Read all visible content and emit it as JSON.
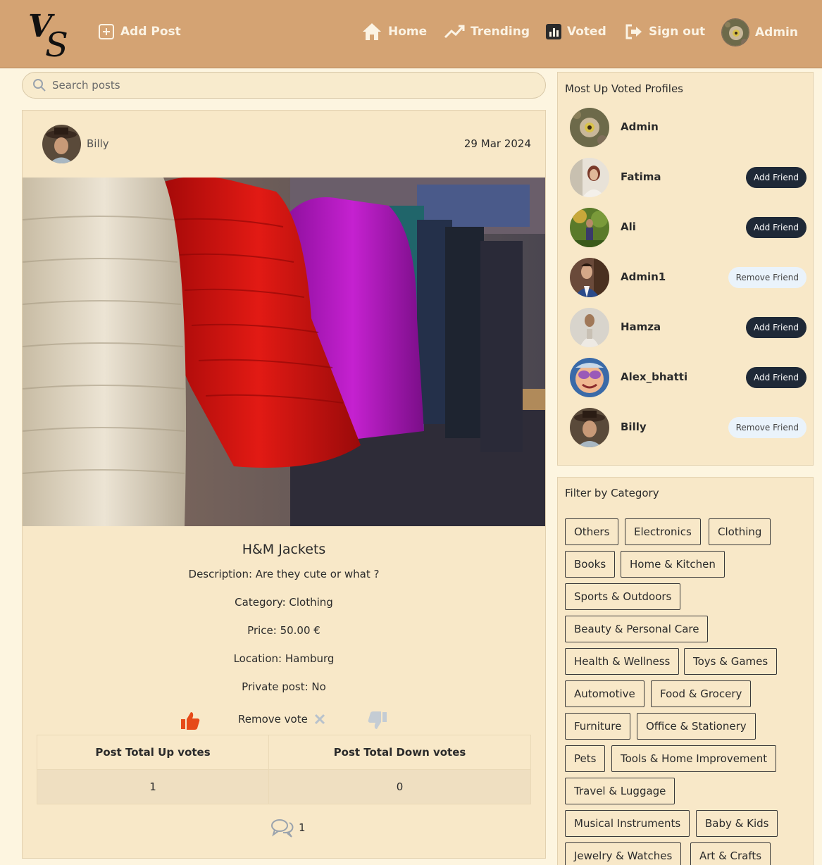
{
  "header": {
    "logo_text": "VS",
    "nav": {
      "add_post": "Add Post",
      "home": "Home",
      "trending": "Trending",
      "voted": "Voted",
      "sign_out": "Sign out",
      "user": "Admin"
    }
  },
  "search": {
    "placeholder": "Search posts"
  },
  "post": {
    "author": "Billy",
    "date": "29 Mar 2024",
    "title": "H&M Jackets",
    "description": "Description: Are they cute or what ?",
    "category": "Category: Clothing",
    "price": "Price: 50.00 €",
    "location": "Location: Hamburg",
    "private": "Private post: No",
    "remove_vote": "Remove vote",
    "votes_table": {
      "headers": [
        "Post Total Up votes",
        "Post Total Down votes"
      ],
      "values": [
        "1",
        "0"
      ]
    },
    "comment_count": "1"
  },
  "profiles": {
    "title": "Most Up Voted Profiles",
    "items": [
      {
        "name": "Admin",
        "action": ""
      },
      {
        "name": "Fatima",
        "action": "Add Friend"
      },
      {
        "name": "Ali",
        "action": "Add Friend"
      },
      {
        "name": "Admin1",
        "action": "Remove Friend"
      },
      {
        "name": "Hamza",
        "action": "Add Friend"
      },
      {
        "name": "Alex_bhatti",
        "action": "Add Friend"
      },
      {
        "name": "Billy",
        "action": "Remove Friend"
      }
    ]
  },
  "categories": {
    "title": "Filter by Category",
    "items": [
      "Others",
      "Electronics",
      "Clothing",
      "Books",
      "Home & Kitchen",
      "Sports & Outdoors",
      "Beauty & Personal Care",
      "Health & Wellness",
      "Toys & Games",
      "Automotive",
      "Food & Grocery",
      "Furniture",
      "Office & Stationery",
      "Pets",
      "Tools & Home Improvement",
      "Travel & Luggage",
      "Musical Instruments",
      "Baby & Kids",
      "Jewelry & Watches",
      "Art & Crafts"
    ]
  },
  "colors": {
    "header_bg": "#d4a373",
    "page_bg": "#fdf5e0",
    "card_bg": "#f8e8c8",
    "upvote_active": "#e64a19",
    "button_dark": "#1f2937"
  }
}
